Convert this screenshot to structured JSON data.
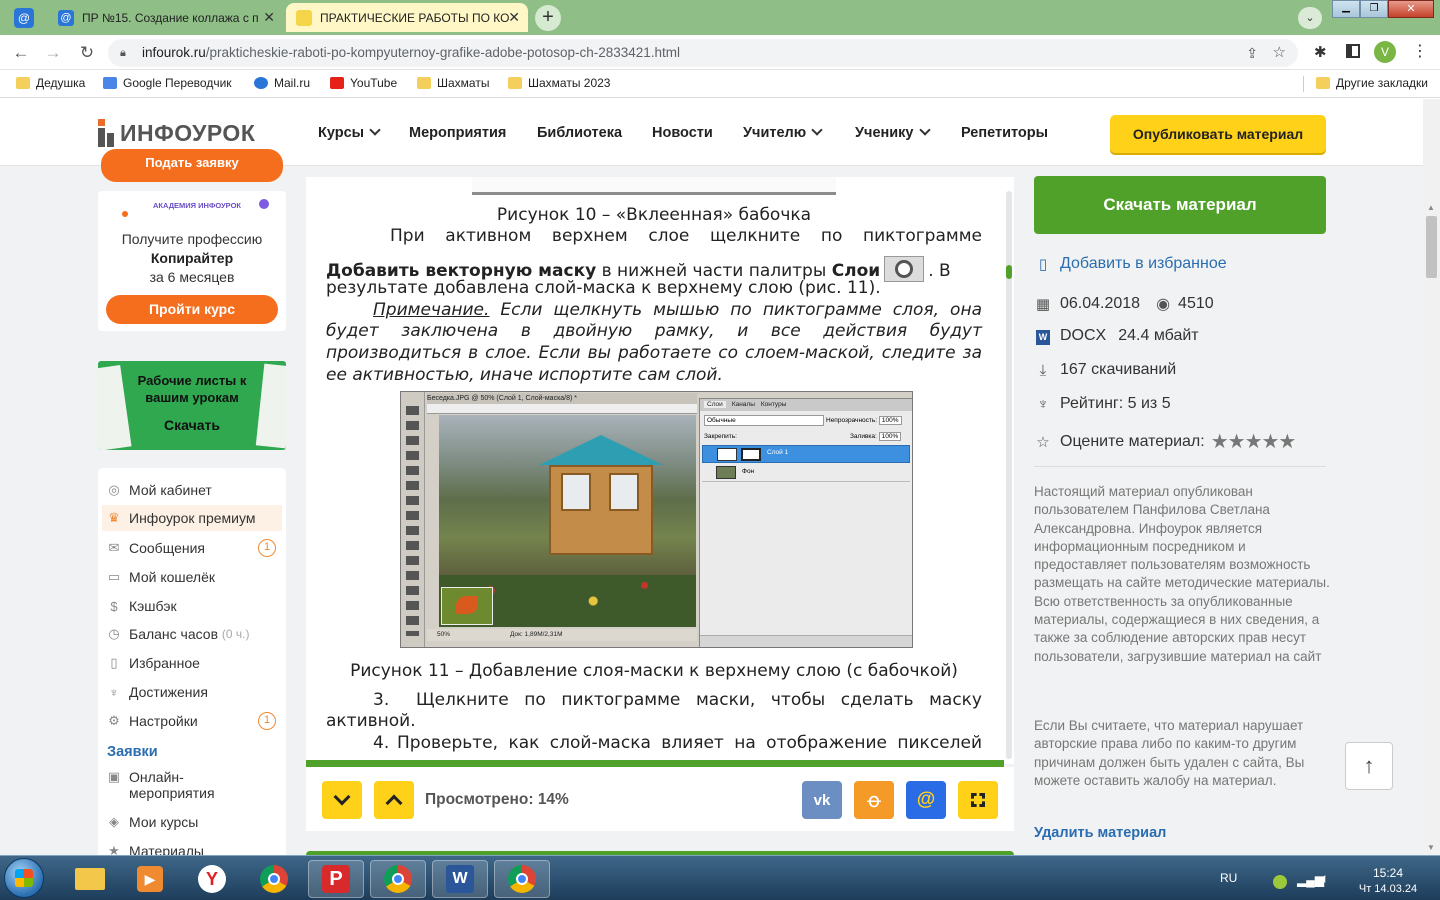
{
  "browser": {
    "tabs": [
      {
        "title": "ПР №15. Создание коллажа с п",
        "active": false
      },
      {
        "title": "ПРАКТИЧЕСКИЕ РАБОТЫ ПО КО",
        "active": true
      }
    ],
    "new_tab": "+",
    "url_domain": "infourok.ru",
    "url_path": "/prakticheskie-raboti-po-kompyuternoy-grafike-adobe-potosop-ch-2833421.html",
    "profile": "V",
    "bookmarks": [
      "Дедушка",
      "Google Переводчик",
      "Mail.ru",
      "YouTube",
      "Шахматы",
      "Шахматы 2023"
    ],
    "other_bookmarks": "Другие закладки"
  },
  "site": {
    "logo": "ИНФОУРОК",
    "nav": [
      "Курсы",
      "Мероприятия",
      "Библиотека",
      "Новости",
      "Учителю",
      "Ученику",
      "Репетиторы"
    ],
    "publish": "Опубликовать материал"
  },
  "left": {
    "request_btn": "Подать заявку",
    "academy_logo": "АКАДЕМИЯ ИНФОУРОК",
    "promo_line1": "Получите профессию",
    "promo_line2": "Копирайтер",
    "promo_line3": "за 6 месяцев",
    "promo_btn": "Пройти курс",
    "worksheets_title": "Рабочие листы к вашим урокам",
    "worksheets_btn": "Скачать",
    "menu": [
      {
        "label": "Мой кабинет",
        "icon": "user-circle-icon"
      },
      {
        "label": "Инфоурок премиум",
        "icon": "crown-icon"
      },
      {
        "label": "Сообщения",
        "icon": "envelope-icon",
        "badge": "1"
      },
      {
        "label": "Мой кошелёк",
        "icon": "wallet-icon"
      },
      {
        "label": "Кэшбэк",
        "icon": "cashback-icon"
      },
      {
        "label": "Баланс часов",
        "icon": "hours-icon",
        "extra": "(0 ч.)"
      },
      {
        "label": "Избранное",
        "icon": "bookmark-icon"
      },
      {
        "label": "Достижения",
        "icon": "trophy-icon"
      },
      {
        "label": "Настройки",
        "icon": "gear-icon",
        "badge": "1"
      }
    ],
    "section": "Заявки",
    "menu2": [
      "Онлайн-мероприятия",
      "Мои курсы",
      "Материалы"
    ]
  },
  "doc": {
    "caption10": "Рисунок 10 – «Вклеенная» бабочка",
    "p1_line1": "При активном верхнем слое щелкните по пиктограмме",
    "p1_bold1": "Добавить векторную маску",
    "p1_mid": " в нижней части палитры ",
    "p1_bold2": "Слои",
    "p1_end": ". В",
    "p1_line3": "результате добавлена слой-маска к верхнему слою (рис. 11).",
    "note_label": "Примечание.",
    "note_line1": " Если щелкнуть мышью по пиктограмме слоя, она",
    "note_line2": "будет заключена в двойную рамку, и все действия будут",
    "note_line3": "производиться в слое. Если вы работаете со слоем-маской, следите за",
    "note_line4": "ее активностью, иначе испортите сам слой.",
    "ps_title": "Беседка.JPG @ 50% (Слой 1, Слой-маска/8) *",
    "ps_zoom": "50%",
    "ps_doc": "Док: 1,89M/2,31M",
    "ps_tabs": [
      "Слои",
      "Каналы",
      "Контуры"
    ],
    "ps_blend": "Обычные",
    "ps_opacity_label": "Непрозрачность:",
    "ps_opacity": "100%",
    "ps_lock": "Закрепить:",
    "ps_fill_label": "Заливка:",
    "ps_fill": "100%",
    "ps_layer1": "Слой 1",
    "ps_layer2": "Фон",
    "caption11": "Рисунок 11 – Добавление слоя-маски к верхнему слою (с бабочкой)",
    "step3_num": "3.",
    "step3_line1": "Щелкните по пиктограмме маски, чтобы сделать маску",
    "step3_line2": "активной.",
    "step4_num": "4.",
    "step4": "Проверьте, как слой-маска влияет на отображение пикселей"
  },
  "docbar": {
    "viewed": "Просмотрено: 14%"
  },
  "right": {
    "download": "Скачать материал",
    "favorite": "Добавить в избранное",
    "date": "06.04.2018",
    "views": "4510",
    "format": "DOCX",
    "size": "24.4 мбайт",
    "downloads": "167 скачиваний",
    "rating": "Рейтинг: 5 из 5",
    "rate": "Оцените материал:",
    "disclaimer": "Настоящий материал опубликован пользователем Панфилова Светлана Александровна. Инфоурок является информационным посредником и предоставляет пользователям возможность размещать на сайте методические материалы. Всю ответственность за опубликованные материалы, содержащиеся в них сведения, а также за соблюдение авторских прав несут пользователи, загрузившие материал на сайт",
    "complaint": "Если Вы считаете, что материал нарушает авторские права либо по каким-то другим причинам должен быть удален с сайта, Вы можете оставить жалобу на материал.",
    "delete": "Удалить материал"
  },
  "taskbar": {
    "lang": "RU",
    "time": "15:24",
    "date": "Чт 14.03.24"
  },
  "colors": {
    "green": "#4fa12a",
    "yellow": "#ffd119",
    "orange": "#f56e1e",
    "tabbar": "#8fbf86"
  }
}
